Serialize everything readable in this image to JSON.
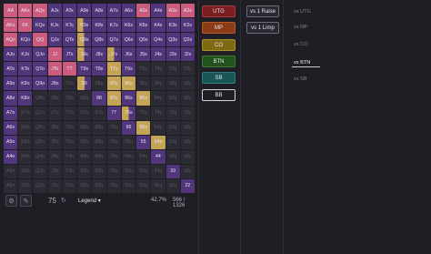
{
  "matrix": {
    "rows": [
      [
        [
          "AA",
          "#cb5c80",
          1,
          ""
        ],
        [
          "AKs",
          "#cb5c80",
          1,
          ""
        ],
        [
          "AQs",
          "#cb5c80",
          1,
          ""
        ],
        [
          "AJs",
          "#52367c",
          1,
          ""
        ],
        [
          "ATs",
          "#52367c",
          1,
          ""
        ],
        [
          "A9s",
          "#52367c",
          1,
          ""
        ],
        [
          "A8s",
          "#52367c",
          1,
          ""
        ],
        [
          "A7s",
          "#52367c",
          1,
          ""
        ],
        [
          "A6s",
          "#52367c",
          1,
          ""
        ],
        [
          "A5s",
          "#cb5c80",
          1,
          ""
        ],
        [
          "A4s",
          "#52367c",
          1,
          ""
        ],
        [
          "A3s",
          "#cb5c80",
          1,
          ""
        ],
        [
          "A2s",
          "#cb5c80",
          1,
          ""
        ]
      ],
      [
        [
          "AKo",
          "#cb5c80",
          1,
          ""
        ],
        [
          "KK",
          "#cb5c80",
          1,
          ""
        ],
        [
          "KQs",
          "#52367c",
          1,
          ""
        ],
        [
          "KJs",
          "#52367c",
          1,
          ""
        ],
        [
          "KTs",
          "#52367c",
          1,
          ""
        ],
        [
          "K9s",
          "#52367c",
          0.55,
          "#c5a458"
        ],
        [
          "K8s",
          "#52367c",
          1,
          ""
        ],
        [
          "K7s",
          "#52367c",
          1,
          ""
        ],
        [
          "K6s",
          "#52367c",
          1,
          ""
        ],
        [
          "K5s",
          "#52367c",
          1,
          ""
        ],
        [
          "K4s",
          "#52367c",
          1,
          ""
        ],
        [
          "K3s",
          "#52367c",
          1,
          ""
        ],
        [
          "K2s",
          "#52367c",
          1,
          ""
        ]
      ],
      [
        [
          "AQo",
          "#cb5c80",
          1,
          ""
        ],
        [
          "KQo",
          "#52367c",
          1,
          ""
        ],
        [
          "QQ",
          "#cb5c80",
          1,
          ""
        ],
        [
          "QJs",
          "#52367c",
          1,
          ""
        ],
        [
          "QTs",
          "#52367c",
          1,
          ""
        ],
        [
          "Q9s",
          "#52367c",
          0.5,
          "#c5a458"
        ],
        [
          "Q8s",
          "#52367c",
          1,
          ""
        ],
        [
          "Q7s",
          "#52367c",
          1,
          ""
        ],
        [
          "Q6s",
          "#52367c",
          1,
          ""
        ],
        [
          "Q5s",
          "#52367c",
          1,
          ""
        ],
        [
          "Q4s",
          "#52367c",
          1,
          ""
        ],
        [
          "Q3s",
          "#52367c",
          1,
          ""
        ],
        [
          "Q2s",
          "#52367c",
          1,
          ""
        ]
      ],
      [
        [
          "AJo",
          "#52367c",
          1,
          ""
        ],
        [
          "KJo",
          "#52367c",
          1,
          ""
        ],
        [
          "QJo",
          "#52367c",
          1,
          ""
        ],
        [
          "JJ",
          "#cb5c80",
          1,
          ""
        ],
        [
          "JTs",
          "#52367c",
          1,
          ""
        ],
        [
          "J9s",
          "#52367c",
          0.5,
          "#c5a458"
        ],
        [
          "J8s",
          "#52367c",
          1,
          ""
        ],
        [
          "J7s",
          "#52367c",
          0.5,
          "#c5a458"
        ],
        [
          "J6s",
          "#52367c",
          1,
          ""
        ],
        [
          "J5s",
          "#52367c",
          1,
          ""
        ],
        [
          "J4s",
          "#52367c",
          1,
          ""
        ],
        [
          "J3s",
          "#52367c",
          1,
          ""
        ],
        [
          "J2s",
          "#52367c",
          1,
          ""
        ]
      ],
      [
        [
          "ATo",
          "#52367c",
          1,
          ""
        ],
        [
          "KTo",
          "#52367c",
          1,
          ""
        ],
        [
          "QTo",
          "#52367c",
          1,
          ""
        ],
        [
          "JTo",
          "#cb5c80",
          1,
          ""
        ],
        [
          "TT",
          "#cb5c80",
          1,
          ""
        ],
        [
          "T9s",
          "#52367c",
          1,
          ""
        ],
        [
          "T8s",
          "#52367c",
          1,
          ""
        ],
        [
          "T7s",
          "#c5a458",
          1,
          ""
        ],
        [
          "T6s",
          "#52367c",
          1,
          ""
        ],
        [
          "T5s",
          "#2c2b33",
          1,
          ""
        ],
        [
          "T4s",
          "#2c2b33",
          1,
          ""
        ],
        [
          "T3s",
          "#2c2b33",
          1,
          ""
        ],
        [
          "T2s",
          "#2c2b33",
          1,
          ""
        ]
      ],
      [
        [
          "A9o",
          "#52367c",
          1,
          ""
        ],
        [
          "K9o",
          "#52367c",
          1,
          ""
        ],
        [
          "Q9o",
          "#52367c",
          1,
          ""
        ],
        [
          "J9o",
          "#52367c",
          1,
          ""
        ],
        [
          "T9o",
          "#2c2b33",
          1,
          ""
        ],
        [
          "99",
          "#52367c",
          0.45,
          "#c5a458"
        ],
        [
          "98s",
          "#2c2b33",
          1,
          ""
        ],
        [
          "97s",
          "#c5a458",
          1,
          ""
        ],
        [
          "96s",
          "#c5a458",
          1,
          ""
        ],
        [
          "95s",
          "#2c2b33",
          1,
          ""
        ],
        [
          "94s",
          "#2c2b33",
          1,
          ""
        ],
        [
          "93s",
          "#2c2b33",
          1,
          ""
        ],
        [
          "92s",
          "#2c2b33",
          1,
          ""
        ]
      ],
      [
        [
          "A8o",
          "#52367c",
          1,
          ""
        ],
        [
          "K8o",
          "#52367c",
          1,
          ""
        ],
        [
          "Q8o",
          "#2c2b33",
          1,
          ""
        ],
        [
          "J8o",
          "#2c2b33",
          1,
          ""
        ],
        [
          "T8o",
          "#2c2b33",
          1,
          ""
        ],
        [
          "98o",
          "#2c2b33",
          1,
          ""
        ],
        [
          "88",
          "#52367c",
          1,
          ""
        ],
        [
          "87s",
          "#c5a458",
          1,
          ""
        ],
        [
          "86s",
          "#52367c",
          1,
          ""
        ],
        [
          "85s",
          "#c5a458",
          1,
          ""
        ],
        [
          "84s",
          "#2c2b33",
          1,
          ""
        ],
        [
          "83s",
          "#2c2b33",
          1,
          ""
        ],
        [
          "82s",
          "#2c2b33",
          1,
          ""
        ]
      ],
      [
        [
          "A7o",
          "#52367c",
          1,
          ""
        ],
        [
          "K7o",
          "#2c2b33",
          1,
          ""
        ],
        [
          "Q7o",
          "#2c2b33",
          1,
          ""
        ],
        [
          "J7o",
          "#2c2b33",
          1,
          ""
        ],
        [
          "T7o",
          "#2c2b33",
          1,
          ""
        ],
        [
          "97o",
          "#2c2b33",
          1,
          ""
        ],
        [
          "87o",
          "#2c2b33",
          1,
          ""
        ],
        [
          "77",
          "#52367c",
          1,
          ""
        ],
        [
          "76s",
          "#52367c",
          0.5,
          "#c5a458"
        ],
        [
          "75s",
          "#2c2b33",
          1,
          ""
        ],
        [
          "74s",
          "#2c2b33",
          1,
          ""
        ],
        [
          "73s",
          "#2c2b33",
          1,
          ""
        ],
        [
          "72s",
          "#2c2b33",
          1,
          ""
        ]
      ],
      [
        [
          "A6o",
          "#52367c",
          1,
          ""
        ],
        [
          "K6o",
          "#2c2b33",
          1,
          ""
        ],
        [
          "Q6o",
          "#2c2b33",
          1,
          ""
        ],
        [
          "J6o",
          "#2c2b33",
          1,
          ""
        ],
        [
          "T6o",
          "#2c2b33",
          1,
          ""
        ],
        [
          "96o",
          "#2c2b33",
          1,
          ""
        ],
        [
          "86o",
          "#2c2b33",
          1,
          ""
        ],
        [
          "76o",
          "#2c2b33",
          1,
          ""
        ],
        [
          "66",
          "#52367c",
          1,
          ""
        ],
        [
          "65s",
          "#c5a458",
          1,
          ""
        ],
        [
          "64s",
          "#2c2b33",
          1,
          ""
        ],
        [
          "63s",
          "#2c2b33",
          1,
          ""
        ],
        [
          "62s",
          "#2c2b33",
          1,
          ""
        ]
      ],
      [
        [
          "A5o",
          "#52367c",
          1,
          ""
        ],
        [
          "K5o",
          "#2c2b33",
          1,
          ""
        ],
        [
          "Q5o",
          "#2c2b33",
          1,
          ""
        ],
        [
          "J5o",
          "#2c2b33",
          1,
          ""
        ],
        [
          "T5o",
          "#2c2b33",
          1,
          ""
        ],
        [
          "95o",
          "#2c2b33",
          1,
          ""
        ],
        [
          "85o",
          "#2c2b33",
          1,
          ""
        ],
        [
          "75o",
          "#2c2b33",
          1,
          ""
        ],
        [
          "65o",
          "#2c2b33",
          1,
          ""
        ],
        [
          "55",
          "#52367c",
          1,
          ""
        ],
        [
          "54s",
          "#c5a458",
          1,
          ""
        ],
        [
          "53s",
          "#2c2b33",
          1,
          ""
        ],
        [
          "52s",
          "#2c2b33",
          1,
          ""
        ]
      ],
      [
        [
          "A4o",
          "#52367c",
          1,
          ""
        ],
        [
          "K4o",
          "#2c2b33",
          1,
          ""
        ],
        [
          "Q4o",
          "#2c2b33",
          1,
          ""
        ],
        [
          "J4o",
          "#2c2b33",
          1,
          ""
        ],
        [
          "T4o",
          "#2c2b33",
          1,
          ""
        ],
        [
          "94o",
          "#2c2b33",
          1,
          ""
        ],
        [
          "84o",
          "#2c2b33",
          1,
          ""
        ],
        [
          "74o",
          "#2c2b33",
          1,
          ""
        ],
        [
          "64o",
          "#2c2b33",
          1,
          ""
        ],
        [
          "54o",
          "#2c2b33",
          1,
          ""
        ],
        [
          "44",
          "#52367c",
          1,
          ""
        ],
        [
          "43s",
          "#2c2b33",
          1,
          ""
        ],
        [
          "42s",
          "#2c2b33",
          1,
          ""
        ]
      ],
      [
        [
          "A3o",
          "#2c2b33",
          1,
          ""
        ],
        [
          "K3o",
          "#2c2b33",
          1,
          ""
        ],
        [
          "Q3o",
          "#2c2b33",
          1,
          ""
        ],
        [
          "J3o",
          "#2c2b33",
          1,
          ""
        ],
        [
          "T3o",
          "#2c2b33",
          1,
          ""
        ],
        [
          "93o",
          "#2c2b33",
          1,
          ""
        ],
        [
          "83o",
          "#2c2b33",
          1,
          ""
        ],
        [
          "73o",
          "#2c2b33",
          1,
          ""
        ],
        [
          "63o",
          "#2c2b33",
          1,
          ""
        ],
        [
          "53o",
          "#2c2b33",
          1,
          ""
        ],
        [
          "43o",
          "#2c2b33",
          1,
          ""
        ],
        [
          "33",
          "#52367c",
          1,
          ""
        ],
        [
          "32s",
          "#2c2b33",
          1,
          ""
        ]
      ],
      [
        [
          "A2o",
          "#2c2b33",
          1,
          ""
        ],
        [
          "K2o",
          "#2c2b33",
          1,
          ""
        ],
        [
          "Q2o",
          "#2c2b33",
          1,
          ""
        ],
        [
          "J2o",
          "#2c2b33",
          1,
          ""
        ],
        [
          "T2o",
          "#2c2b33",
          1,
          ""
        ],
        [
          "92o",
          "#2c2b33",
          1,
          ""
        ],
        [
          "82o",
          "#2c2b33",
          1,
          ""
        ],
        [
          "72o",
          "#2c2b33",
          1,
          ""
        ],
        [
          "62o",
          "#2c2b33",
          1,
          ""
        ],
        [
          "52o",
          "#2c2b33",
          1,
          ""
        ],
        [
          "42o",
          "#2c2b33",
          1,
          ""
        ],
        [
          "32o",
          "#2c2b33",
          1,
          ""
        ],
        [
          "22",
          "#52367c",
          1,
          ""
        ]
      ]
    ]
  },
  "bottom_bar": {
    "settings_icon": "gear-icon",
    "tool_icon": "eyedropper-icon",
    "zoom": "75",
    "legend_label": "Legend ▾",
    "percent": "42.7%",
    "combos": "566 / 1326"
  },
  "positions": [
    {
      "label": "UTG",
      "bg": "#7a1e22",
      "border": "#a33a3e"
    },
    {
      "label": "MP",
      "bg": "#8c3d17",
      "border": "#b25a2c"
    },
    {
      "label": "CO",
      "bg": "#7d6a12",
      "border": "#a68f2a"
    },
    {
      "label": "BTN",
      "bg": "#23531c",
      "border": "#3c7a33"
    },
    {
      "label": "SB",
      "bg": "#1a5557",
      "border": "#2f7a7c"
    },
    {
      "label": "BB",
      "bg": "#1f1e25",
      "border": "#d6d6de"
    }
  ],
  "actions": [
    {
      "label": "vs 1 Raise"
    },
    {
      "label": "vs 1 Limp"
    }
  ],
  "vs_list": [
    {
      "label": "vs UTG",
      "active": false
    },
    {
      "label": "vs MP",
      "active": false
    },
    {
      "label": "vs CO",
      "active": false
    },
    {
      "label": "vs BTN",
      "active": true
    },
    {
      "label": "vs SB",
      "active": false
    }
  ]
}
